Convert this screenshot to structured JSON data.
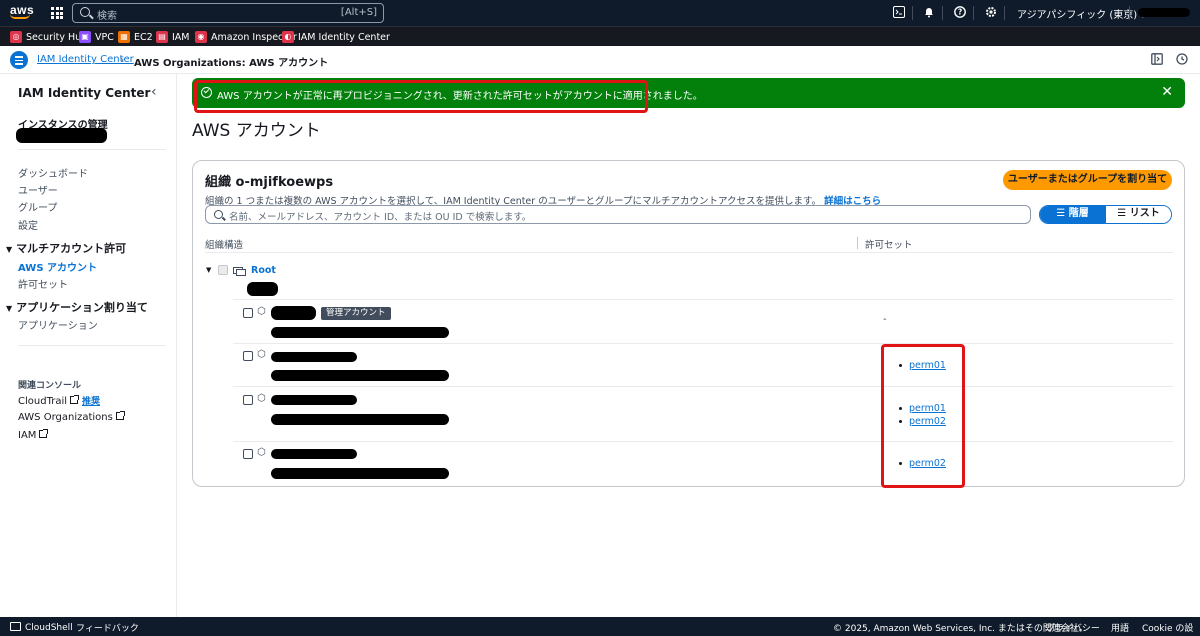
{
  "topnav": {
    "logo_text": "aws",
    "search_placeholder": "検索",
    "search_shortcut": "[Alt+S]",
    "region": "アジアパシフィック (東京) ▾"
  },
  "favorites": [
    {
      "label": "Security Hub",
      "color": "#dd344c",
      "glyph": "◎"
    },
    {
      "label": "VPC",
      "color": "#8c4fff",
      "glyph": "▣"
    },
    {
      "label": "EC2",
      "color": "#ed7100",
      "glyph": "▦"
    },
    {
      "label": "IAM",
      "color": "#dd344c",
      "glyph": "▤"
    },
    {
      "label": "Amazon Inspector",
      "color": "#dd344c",
      "glyph": "◉"
    },
    {
      "label": "IAM Identity Center",
      "color": "#dd344c",
      "glyph": "◐"
    }
  ],
  "breadcrumb": {
    "parent": "IAM Identity Center",
    "current": "AWS Organizations: AWS アカウント"
  },
  "sidebar": {
    "title": "IAM Identity Center",
    "instance_label": "インスタンスの管理",
    "links_top": [
      "ダッシュボード",
      "ユーザー",
      "グループ",
      "設定"
    ],
    "section_multi": "マルチアカウント許可",
    "multi_items": [
      "AWS アカウント",
      "許可セット"
    ],
    "section_app": "アプリケーション割り当て",
    "app_items": [
      "アプリケーション"
    ],
    "related_title": "関連コンソール",
    "related": [
      "CloudTrail",
      "AWS Organizations",
      "IAM"
    ],
    "new_badge": "推奨"
  },
  "flash": {
    "message": "AWS アカウントが正常に再プロビジョニングされ、更新された許可セットがアカウントに適用されました。",
    "color": "#037f0c"
  },
  "page": {
    "title": "AWS アカウント"
  },
  "org": {
    "title": "組織 o-mjifkoewps",
    "assign_button": "ユーザーまたはグループを割り当て",
    "description": "組織の 1 つまたは複数の AWS アカウントを選択して、IAM Identity Center のユーザーとグループにマルチアカウントアクセスを提供します。",
    "learn_more": "詳細はこちら",
    "filter_placeholder": "名前、メールアドレス、アカウント ID、または OU ID で検索します。",
    "view_hierarchy": "階層",
    "view_list": "リスト",
    "col_structure": "組織構造",
    "col_permsets": "許可セット",
    "root_label": "Root",
    "mgmt_badge": "管理アカウント",
    "empty_dash": "-",
    "accounts": [
      {
        "permsets": []
      },
      {
        "permsets": [
          "perm01"
        ]
      },
      {
        "permsets": [
          "perm01",
          "perm02"
        ]
      },
      {
        "permsets": [
          "perm02"
        ]
      }
    ]
  },
  "footer": {
    "cloudshell": "CloudShell",
    "feedback": "フィードバック",
    "copyright": "© 2025, Amazon Web Services, Inc. またはその関連会社。",
    "privacy": "プライバシー",
    "terms": "用語",
    "cookie": "Cookie の設定"
  }
}
